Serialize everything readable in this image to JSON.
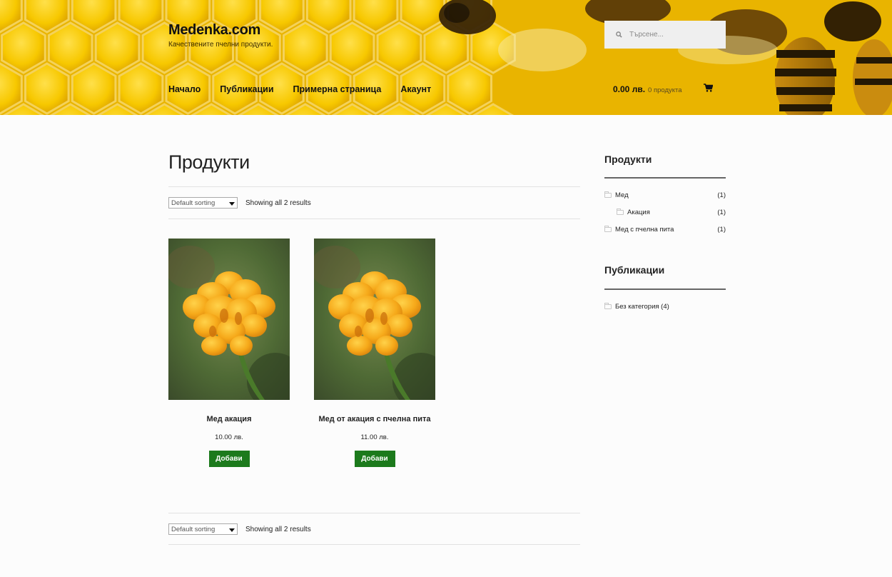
{
  "header": {
    "site_title": "Medenka.com",
    "tagline": "Качествените пчелни продукти.",
    "nav": [
      "Начало",
      "Публикации",
      "Примерна страница",
      "Акаунт"
    ],
    "search_placeholder": "Търсене...",
    "cart_amount": "0.00 лв.",
    "cart_count": "0 продукта",
    "background_colors": {
      "honey": "#f5c400",
      "honey_light": "#ffd930",
      "bee_dark": "#2a1a05"
    }
  },
  "main": {
    "title": "Продукти",
    "sorting": "Default sorting",
    "results": "Showing all 2 results",
    "products": [
      {
        "name": "Мед акация",
        "price": "10.00 лв.",
        "button": "Добави"
      },
      {
        "name": "Мед от акация с пчелна пита",
        "price": "11.00 лв.",
        "button": "Добави"
      }
    ]
  },
  "sidebar": {
    "products_title": "Продукти",
    "categories": [
      {
        "label": "Мед",
        "count": "(1)",
        "level": 0
      },
      {
        "label": "Акация",
        "count": "(1)",
        "level": 1
      },
      {
        "label": "Мед с пчелна пита",
        "count": "(1)",
        "level": 0
      }
    ],
    "posts_title": "Публикации",
    "post_categories": [
      {
        "label": "Без категория (4)"
      }
    ]
  },
  "colors": {
    "button_green": "#1c7a1c",
    "rule": "#666666",
    "divider": "#e2e2e2"
  }
}
